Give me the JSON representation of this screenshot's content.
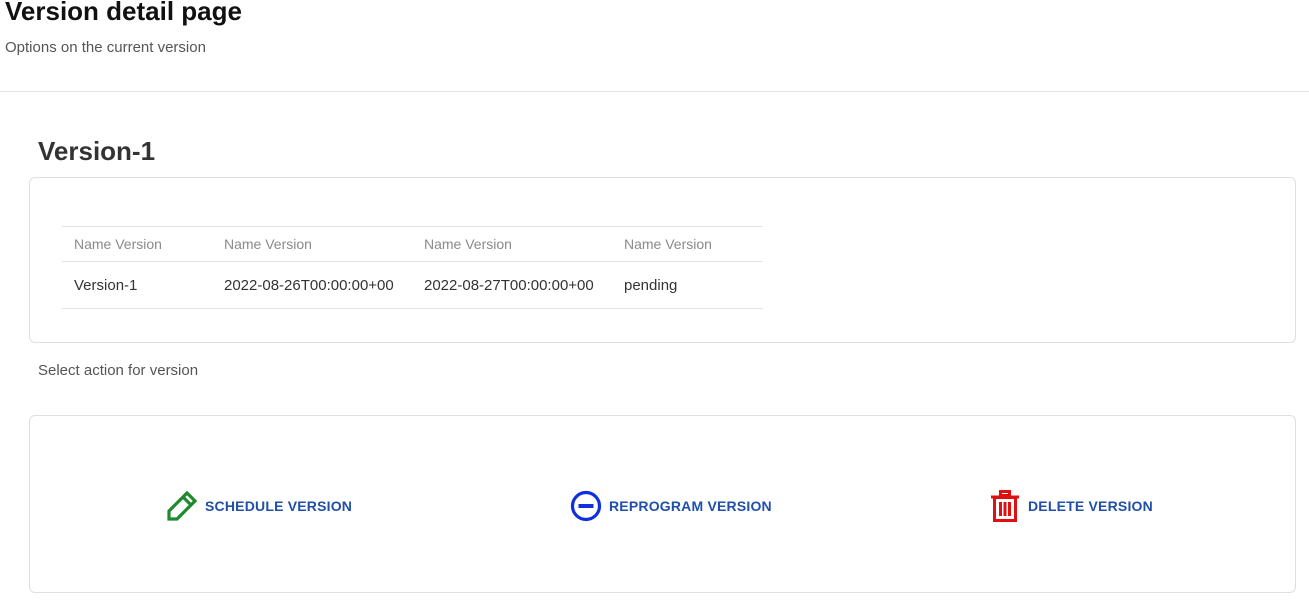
{
  "header": {
    "title": "Version detail page",
    "subtitle": "Options on the current version"
  },
  "version": {
    "heading": "Version-1",
    "table": {
      "columns": [
        "Name Version",
        "Name Version",
        "Name Version",
        "Name Version"
      ],
      "rows": [
        [
          "Version-1",
          "2022-08-26T00:00:00+00",
          "2022-08-27T00:00:00+00",
          "pending"
        ]
      ]
    }
  },
  "actions_section": {
    "label": "Select action for version",
    "actions": [
      {
        "label": "SCHEDULE VERSION",
        "icon": "pencil-icon",
        "color": "#1e8a2e"
      },
      {
        "label": "REPROGRAM VERSION",
        "icon": "minus-circle-icon",
        "color": "#1030e0"
      },
      {
        "label": "DELETE VERSION",
        "icon": "trash-icon",
        "color": "#e01010"
      }
    ],
    "label_color": "#1f4fa8"
  }
}
